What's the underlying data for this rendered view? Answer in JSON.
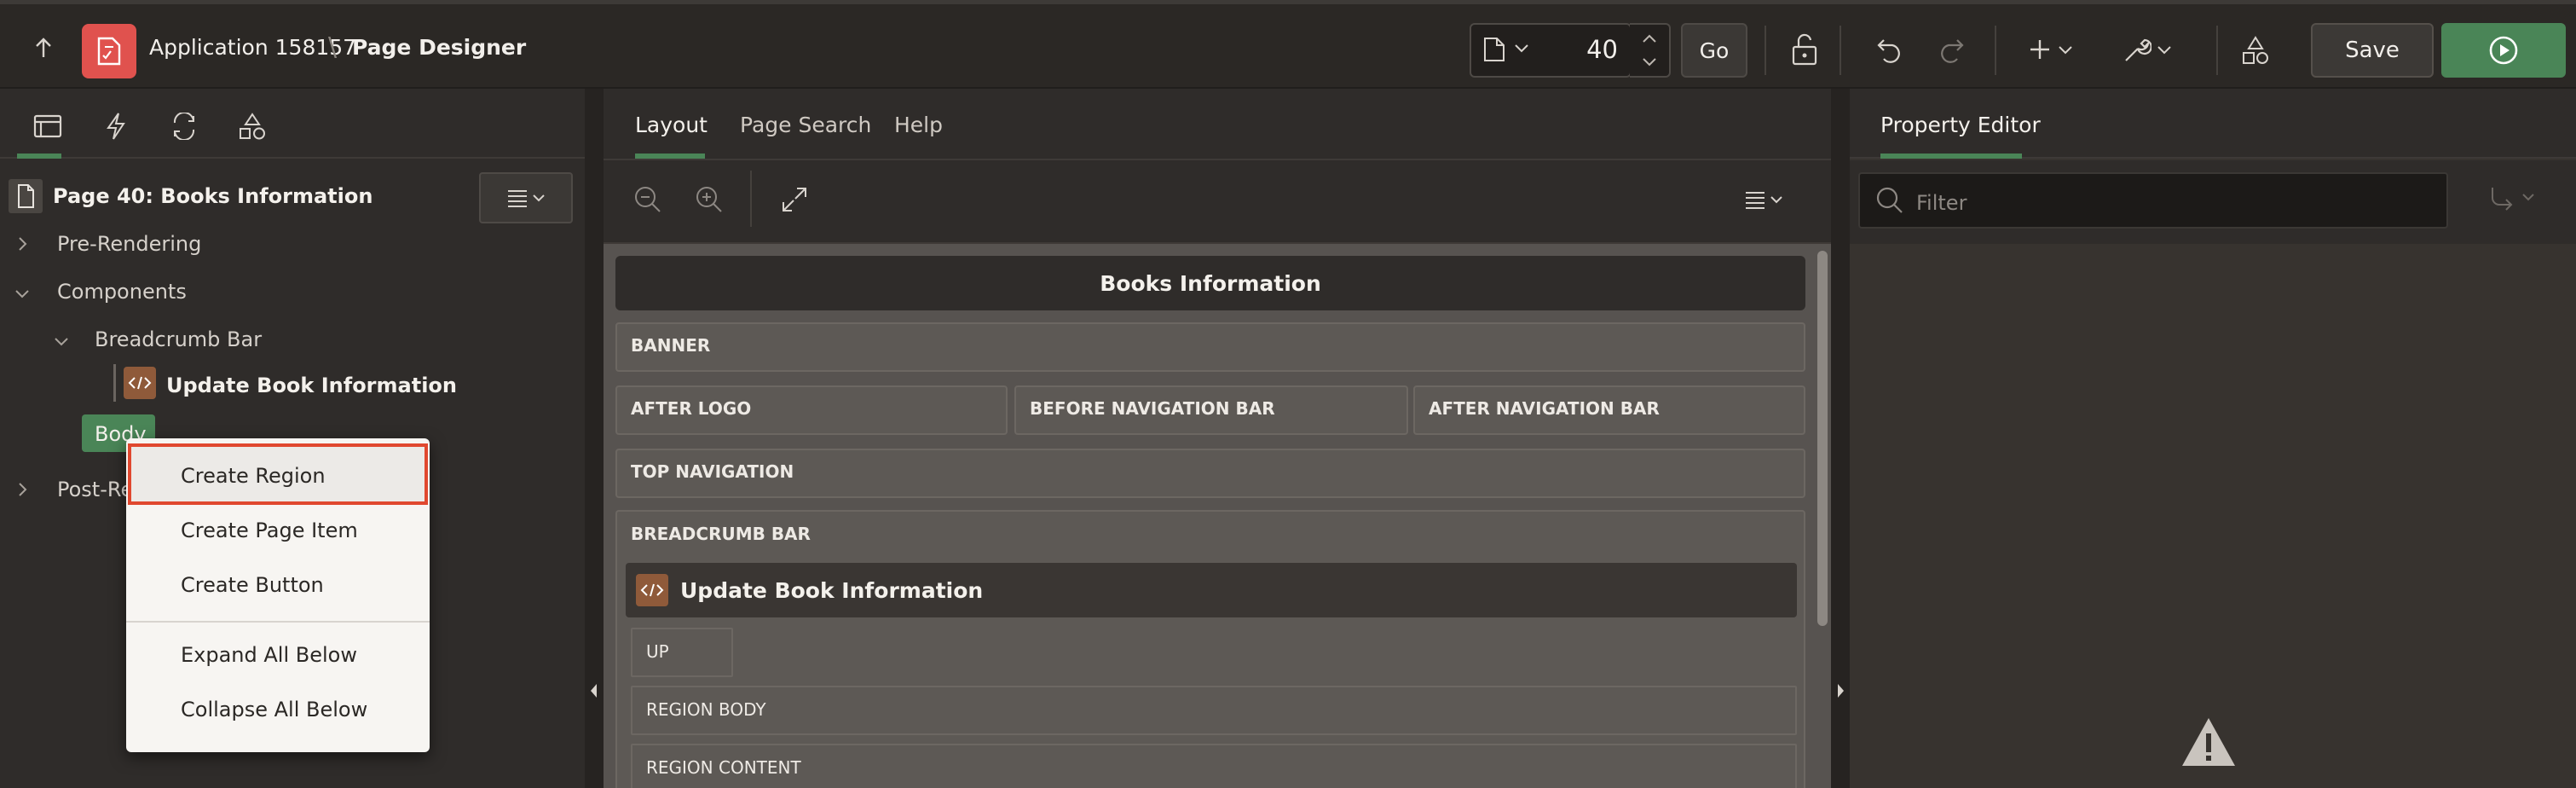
{
  "header": {
    "app_title": "Application 158157",
    "separator": "\\",
    "page_title": "Page Designer",
    "page_number": "40",
    "go_label": "Go",
    "save_label": "Save"
  },
  "left_panel": {
    "tabs": [
      "rendering",
      "dynamic-actions",
      "processing",
      "shared-components"
    ],
    "page_title": "Page 40: Books Information",
    "tree": {
      "pre_rendering": "Pre-Rendering",
      "components": "Components",
      "breadcrumb_bar": "Breadcrumb Bar",
      "update_book": "Update Book Information",
      "body": "Body",
      "post_rendering": "Post-Re"
    }
  },
  "context_menu": {
    "items": [
      "Create Region",
      "Create Page Item",
      "Create Button",
      "Expand All Below",
      "Collapse All Below"
    ],
    "selected": "Create Region"
  },
  "center_panel": {
    "tabs": [
      "Layout",
      "Page Search",
      "Help"
    ],
    "active_tab": "Layout",
    "canvas_title": "Books Information",
    "slots": {
      "banner": "BANNER",
      "after_logo": "AFTER LOGO",
      "before_nav": "BEFORE NAVIGATION BAR",
      "after_nav": "AFTER NAVIGATION BAR",
      "top_nav": "TOP NAVIGATION",
      "breadcrumb_bar": "BREADCRUMB BAR",
      "region_title": "Update Book Information",
      "up": "UP",
      "region_body": "REGION BODY",
      "region_content": "REGION CONTENT"
    }
  },
  "right_panel": {
    "tab": "Property Editor",
    "filter_placeholder": "Filter"
  },
  "colors": {
    "accent_green": "#4a8557",
    "app_icon_red": "#e0524e",
    "selection_outline": "#e0482f",
    "code_icon": "#8f5a3a"
  }
}
